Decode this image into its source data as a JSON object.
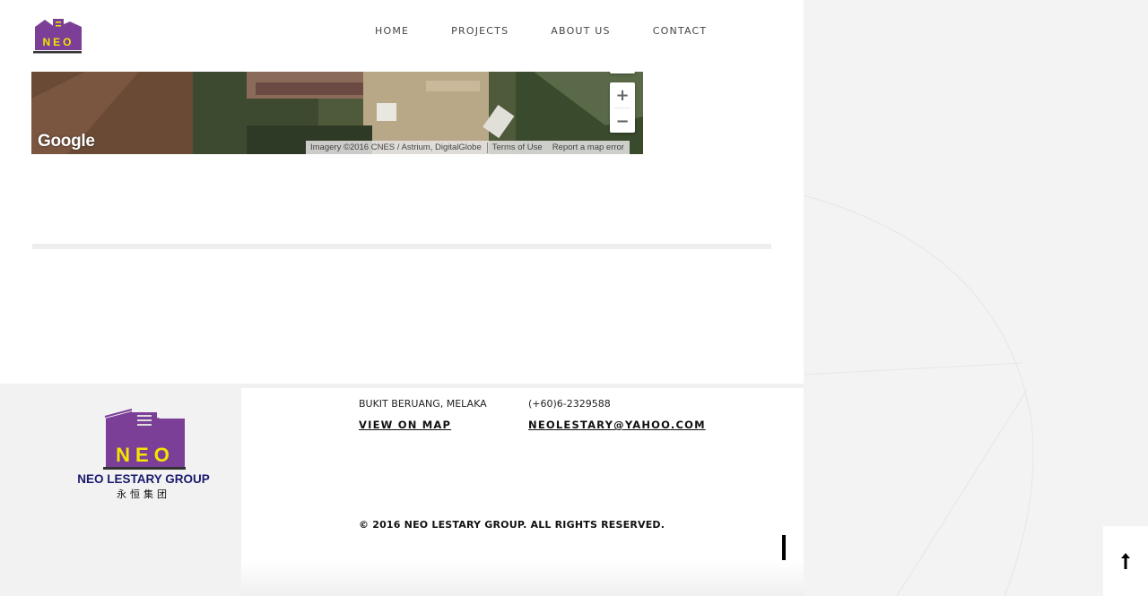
{
  "header": {
    "logo_alt": "NEO",
    "nav": [
      "HOME",
      "PROJECTS",
      "ABOUT US",
      "CONTACT"
    ]
  },
  "map": {
    "brand": "Google",
    "attribution": "Imagery ©2016 CNES / Astrium, DigitalGlobe",
    "terms_label": "Terms of Use",
    "report_label": "Report a map error",
    "zoom_in": "+",
    "zoom_out": "−"
  },
  "footer": {
    "logo_text": "NEO",
    "company_name": "NEO LESTARY GROUP",
    "company_chinese": "永恒集团",
    "address": "BUKIT BERUANG, MELAKA",
    "phone": "(+60)6-2329588",
    "view_map_label": "VIEW ON MAP",
    "email": "NEOLESTARY@YAHOO.COM",
    "copyright": "© 2016 NEO LESTARY GROUP. ALL RIGHTS RESERVED."
  },
  "scroll_top_icon": "arrow-up-icon",
  "colors": {
    "brand_purple": "#7b3f98",
    "brand_yellow": "#f5e400",
    "brand_navy": "#1a1a6e"
  }
}
